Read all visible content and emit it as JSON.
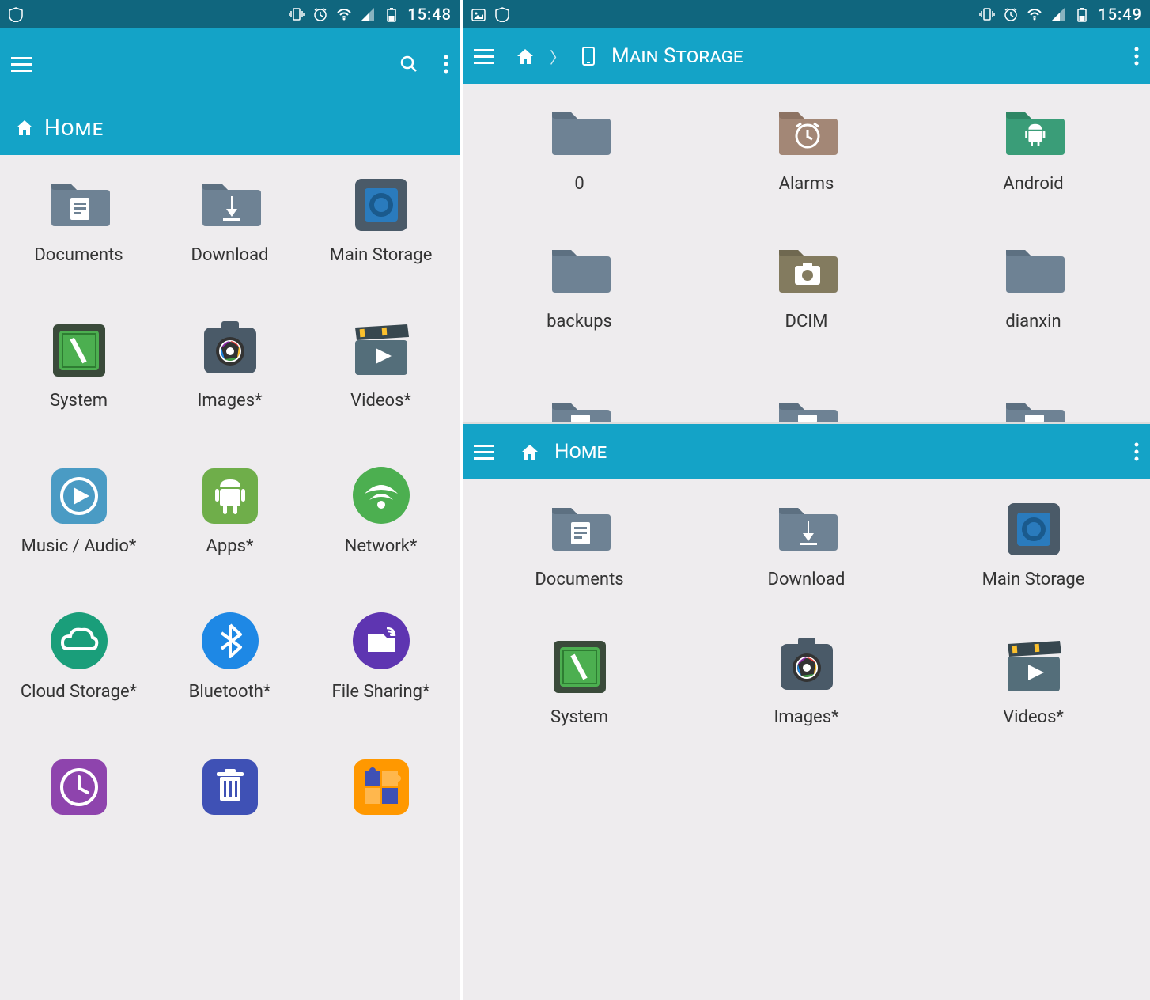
{
  "left": {
    "statusbar": {
      "time": "15:48"
    },
    "breadcrumb": {
      "title": "Home"
    },
    "items": [
      {
        "label": "Documents"
      },
      {
        "label": "Download"
      },
      {
        "label": "Main Storage"
      },
      {
        "label": "System"
      },
      {
        "label": "Images*"
      },
      {
        "label": "Videos*"
      },
      {
        "label": "Music / Audio*"
      },
      {
        "label": "Apps*"
      },
      {
        "label": "Network*"
      },
      {
        "label": "Cloud Storage*"
      },
      {
        "label": "Bluetooth*"
      },
      {
        "label": "File Sharing*"
      },
      {
        "label": ""
      },
      {
        "label": ""
      },
      {
        "label": ""
      }
    ]
  },
  "right": {
    "statusbar": {
      "time": "15:49"
    },
    "top": {
      "breadcrumb": {
        "title": "Main Storage"
      },
      "items": [
        {
          "label": "0"
        },
        {
          "label": "Alarms"
        },
        {
          "label": "Android"
        },
        {
          "label": "backups"
        },
        {
          "label": "DCIM"
        },
        {
          "label": "dianxin"
        },
        {
          "label": ""
        },
        {
          "label": ""
        },
        {
          "label": ""
        }
      ]
    },
    "bottom": {
      "breadcrumb": {
        "title": "Home"
      },
      "items": [
        {
          "label": "Documents"
        },
        {
          "label": "Download"
        },
        {
          "label": "Main Storage"
        },
        {
          "label": "System"
        },
        {
          "label": "Images*"
        },
        {
          "label": "Videos*"
        }
      ]
    }
  }
}
